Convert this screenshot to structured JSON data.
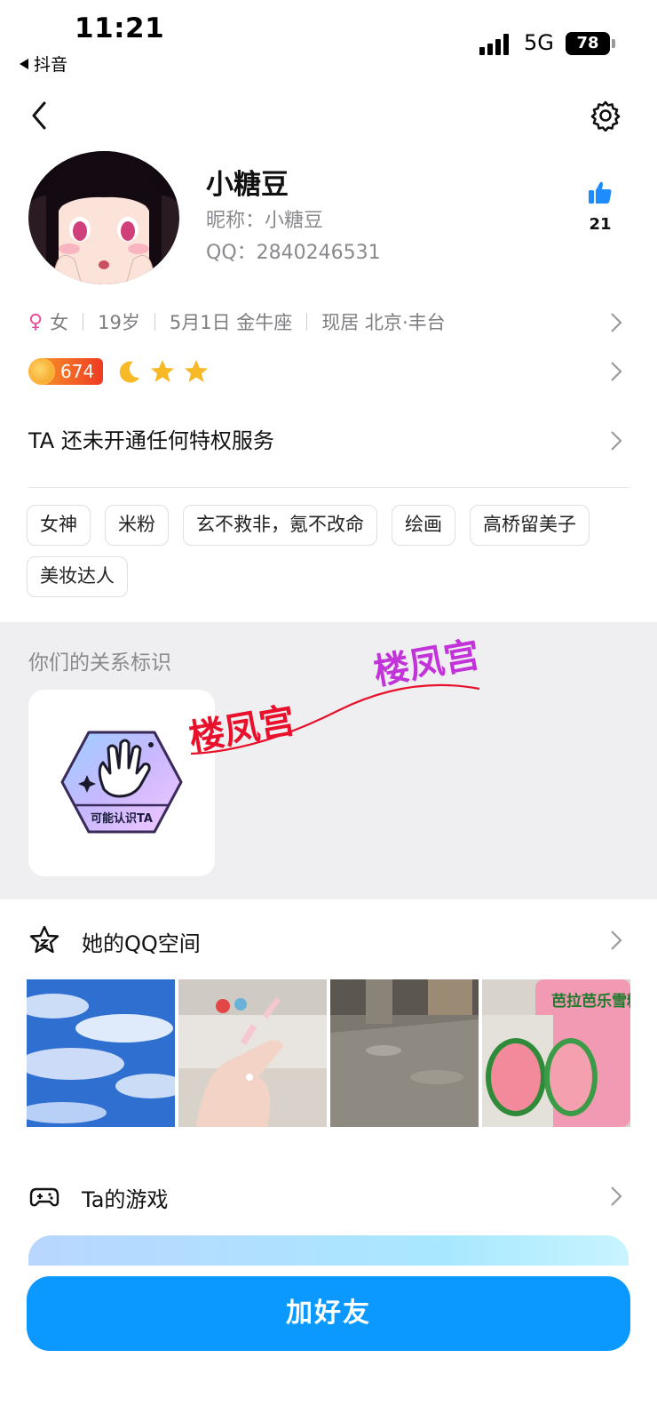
{
  "status_bar": {
    "time": "11:21",
    "back_app": "抖音",
    "network": "5G",
    "battery": "78"
  },
  "profile": {
    "name": "小糖豆",
    "nickname": "昵称：小糖豆",
    "qq": "QQ：2840246531",
    "likes": "21"
  },
  "info": {
    "gender": "女",
    "age": "19岁",
    "birthday": "5月1日 金牛座",
    "location": "现居 北京·丰台"
  },
  "level": {
    "value": "674"
  },
  "privilege": "TA 还未开通任何特权服务",
  "tags": [
    "女神",
    "米粉",
    "玄不救非，氪不改命",
    "绘画",
    "高桥留美子",
    "美妆达人"
  ],
  "relation": {
    "title": "你们的关系标识",
    "badge": "可能认识TA",
    "watermark_1": "楼凤宫",
    "watermark_2": "楼凤宫"
  },
  "qzone": {
    "label": "她的QQ空间",
    "photo_4_text": "芭拉芭乐雪糕"
  },
  "games": {
    "label": "Ta的游戏"
  },
  "add_button": "加好友",
  "colors": {
    "accent": "#0b99ff",
    "female": "#e84e9f",
    "like": "#1e8cff"
  }
}
